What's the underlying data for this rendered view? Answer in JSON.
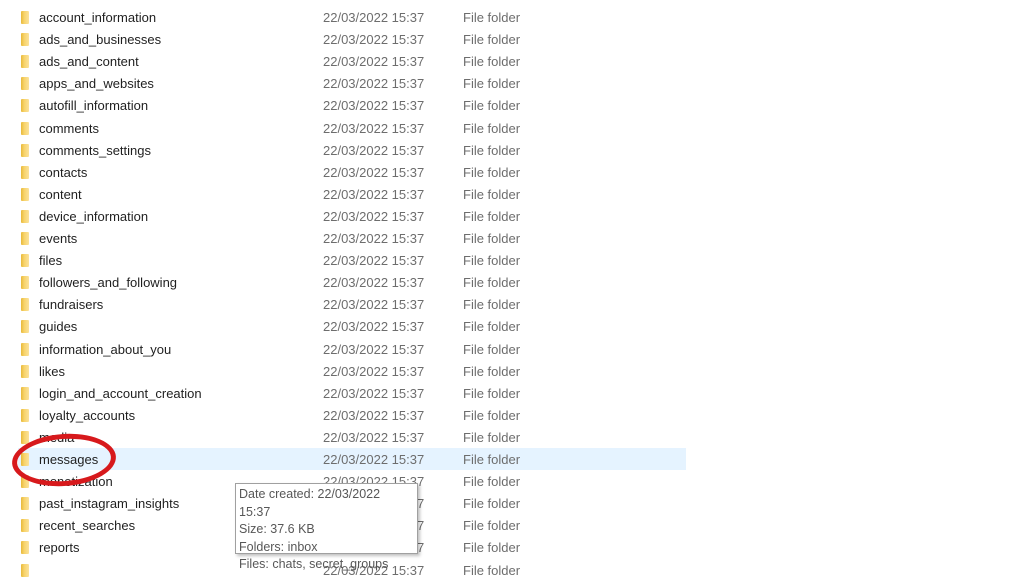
{
  "folder_list": {
    "type_label": "File folder",
    "date": "22/03/2022 15:37",
    "items": [
      {
        "name": "account_information"
      },
      {
        "name": "ads_and_businesses"
      },
      {
        "name": "ads_and_content"
      },
      {
        "name": "apps_and_websites"
      },
      {
        "name": "autofill_information"
      },
      {
        "name": "comments"
      },
      {
        "name": "comments_settings"
      },
      {
        "name": "contacts"
      },
      {
        "name": "content"
      },
      {
        "name": "device_information"
      },
      {
        "name": "events"
      },
      {
        "name": "files"
      },
      {
        "name": "followers_and_following"
      },
      {
        "name": "fundraisers"
      },
      {
        "name": "guides"
      },
      {
        "name": "information_about_you"
      },
      {
        "name": "likes"
      },
      {
        "name": "login_and_account_creation"
      },
      {
        "name": "loyalty_accounts"
      },
      {
        "name": "media"
      },
      {
        "name": "messages",
        "selected": true
      },
      {
        "name": "monetization"
      },
      {
        "name": "past_instagram_insights"
      },
      {
        "name": "recent_searches"
      },
      {
        "name": "reports"
      },
      {
        "name": ""
      }
    ]
  },
  "tooltip": {
    "date_created": "Date created: 22/03/2022 15:37",
    "size": "Size: 37.6 KB",
    "folders": "Folders: inbox",
    "files": "Files: chats, secret_groups"
  },
  "annotation_color": "#d7191c",
  "selection_color": "#e5f3ff"
}
